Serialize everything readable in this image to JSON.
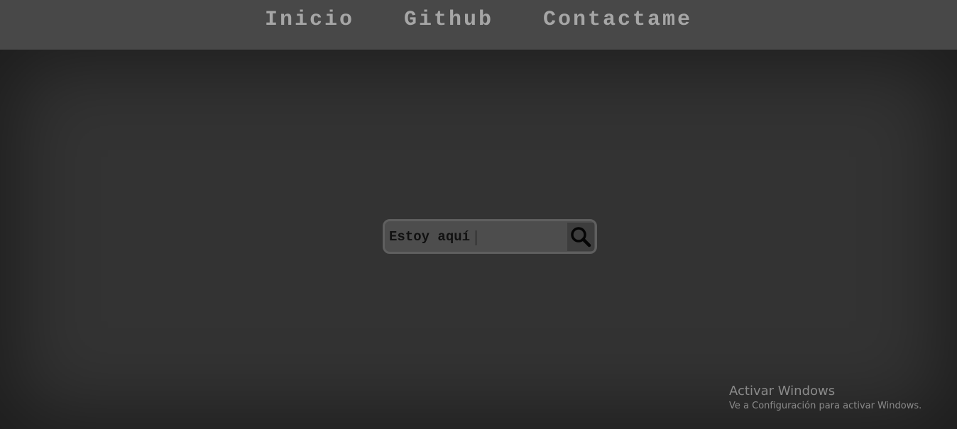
{
  "nav": {
    "links": [
      {
        "label": "Inicio"
      },
      {
        "label": "Github"
      },
      {
        "label": "Contactame"
      }
    ]
  },
  "search": {
    "value": "Estoy aquí",
    "button_icon": "search-icon"
  },
  "watermark": {
    "title": "Activar Windows",
    "subtitle": "Ve a Configuración para activar Windows."
  },
  "colors": {
    "background": "#333333",
    "navbar": "#484848",
    "nav_text": "#a6a6a6",
    "search_bg": "#4d4d4d"
  }
}
